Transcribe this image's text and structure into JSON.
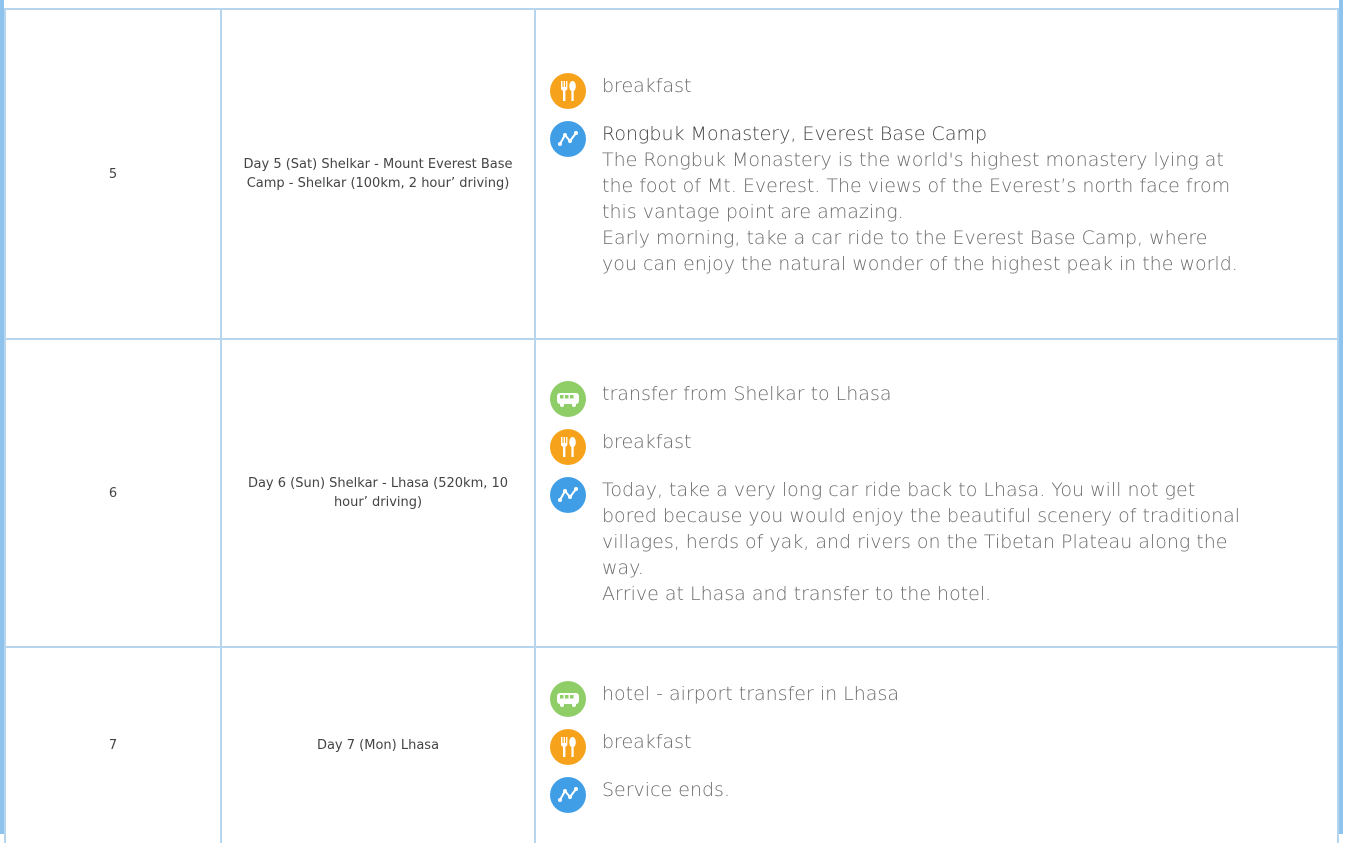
{
  "rows": [
    {
      "day": "5",
      "title": "Day 5 (Sat) Shelkar - Mount Everest Base Camp - Shelkar (100km, 2 hour’ driving)",
      "activities": [
        {
          "icon": "meal-icon",
          "text": "breakfast"
        },
        {
          "icon": "route-icon",
          "title": "Rongbuk Monastery, Everest Base Camp",
          "paragraphs": [
            "The Rongbuk Monastery is the world's highest monastery lying at the foot of Mt. Everest. The views of the Everest’s north face from this vantage point are amazing.",
            "Early morning, take a car ride to the Everest Base Camp, where you can enjoy the natural wonder of the highest peak in the world."
          ]
        }
      ]
    },
    {
      "day": "6",
      "title": "Day 6 (Sun) Shelkar - Lhasa (520km, 10 hour’ driving)",
      "activities": [
        {
          "icon": "bus-icon",
          "text": "transfer from Shelkar to Lhasa"
        },
        {
          "icon": "meal-icon",
          "text": "breakfast"
        },
        {
          "icon": "route-icon",
          "paragraphs": [
            "Today, take a very long car ride back to Lhasa. You will not get bored because you would enjoy the beautiful scenery of traditional villages, herds of yak, and rivers on the Tibetan Plateau along the way.",
            "Arrive at Lhasa and transfer to the hotel."
          ]
        }
      ]
    },
    {
      "day": "7",
      "title": "Day 7 (Mon) Lhasa",
      "activities": [
        {
          "icon": "bus-icon",
          "text": "hotel - airport transfer in Lhasa"
        },
        {
          "icon": "meal-icon",
          "text": "breakfast"
        },
        {
          "icon": "route-icon",
          "text": "Service ends."
        }
      ]
    }
  ],
  "colors": {
    "border": "#b7d6ee",
    "edge": "#8ec3ee",
    "meal": "#f6a31b",
    "route": "#3f9ee6",
    "bus": "#8fcd67"
  }
}
